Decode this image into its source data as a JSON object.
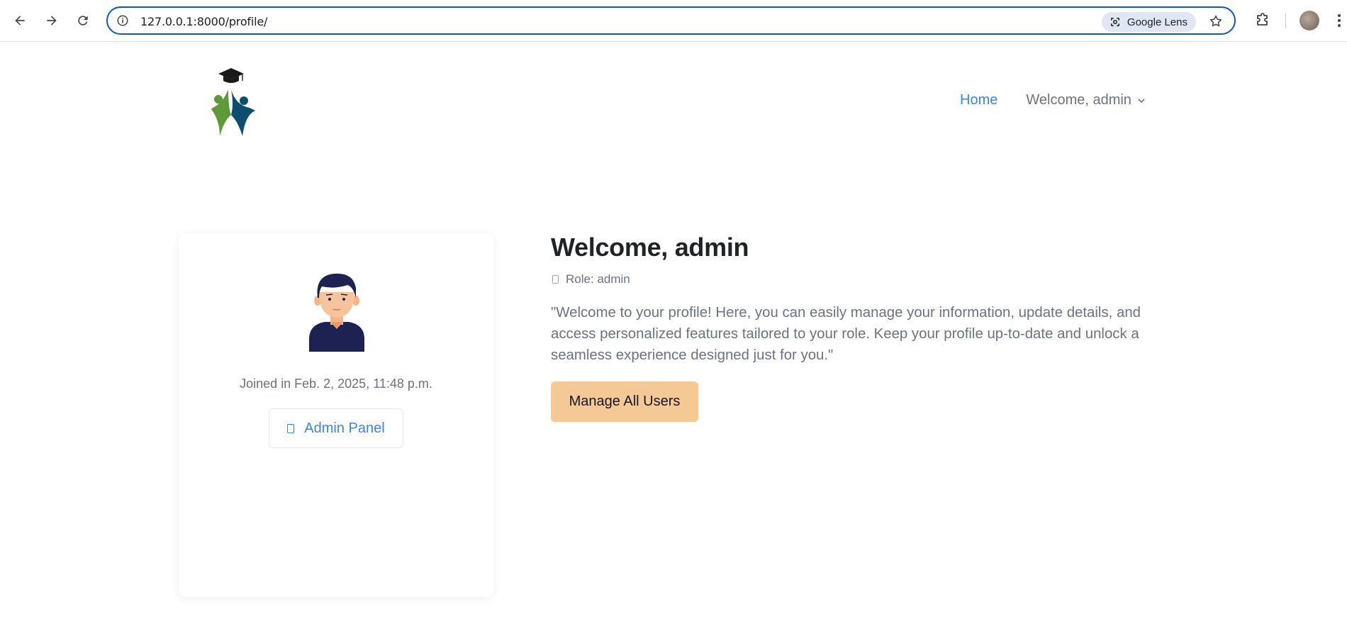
{
  "browser": {
    "url": "127.0.0.1:8000/profile/",
    "lens_label": "Google Lens"
  },
  "header": {
    "nav_home": "Home",
    "nav_user": "Welcome, admin"
  },
  "card": {
    "joined": "Joined in Feb. 2, 2025, 11:48 p.m.",
    "admin_panel_label": "Admin Panel"
  },
  "main": {
    "title": "Welcome, admin",
    "role": "Role: admin",
    "description": "\"Welcome to your profile! Here, you can easily manage your information, update details, and access personalized features tailored to your role. Keep your profile up-to-date and unlock a seamless experience designed just for you.\"",
    "manage_button": "Manage All Users"
  },
  "colors": {
    "link": "#3b82f6",
    "muted_text": "#6b7280",
    "manage_button_bg": "#f5c995",
    "omnibox_border": "#0b57d0"
  },
  "icons": [
    "back-arrow-icon",
    "forward-arrow-icon",
    "reload-icon",
    "site-info-icon",
    "google-lens-icon",
    "bookmark-star-icon",
    "extensions-icon",
    "chevron-down-icon"
  ]
}
